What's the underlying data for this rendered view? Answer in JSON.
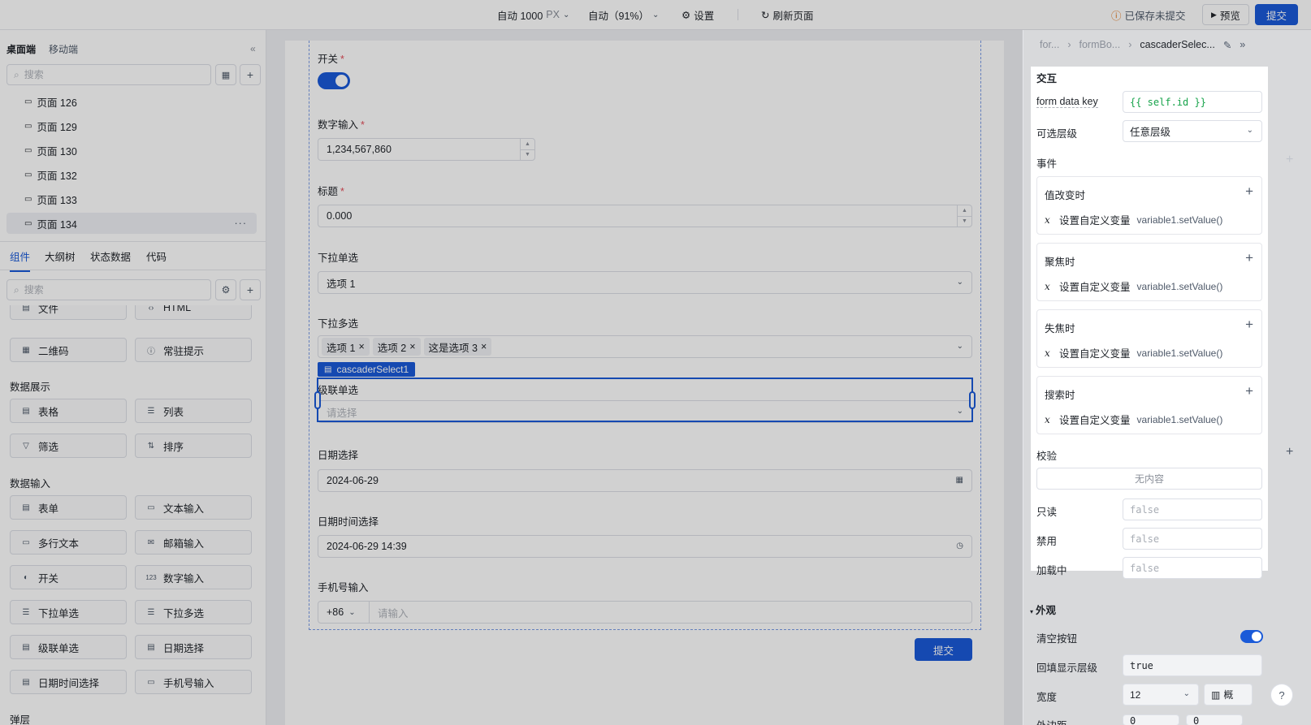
{
  "topbar": {
    "width_value": "自动 1000",
    "width_unit": "PX",
    "zoom": "自动（91%）",
    "settings": "设置",
    "refresh": "刷新页面",
    "save_status": "已保存未提交",
    "preview": "预览",
    "submit": "提交"
  },
  "left": {
    "tab_desktop": "桌面端",
    "tab_mobile": "移动端",
    "page_search_placeholder": "搜索",
    "pages": [
      "页面 126",
      "页面 129",
      "页面 130",
      "页面 132",
      "页面 133",
      "页面 134"
    ],
    "panel_tabs": [
      "组件",
      "大纲树",
      "状态数据",
      "代码"
    ],
    "component_search_placeholder": "搜索",
    "partial_row": [
      "文件",
      "HTML"
    ],
    "row_misc": [
      "二维码",
      "常驻提示"
    ],
    "section_display": "数据展示",
    "display_items": [
      "表格",
      "列表",
      "筛选",
      "排序"
    ],
    "section_input": "数据输入",
    "input_items": [
      "表单",
      "文本输入",
      "多行文本",
      "邮箱输入",
      "开关",
      "数字输入",
      "下拉单选",
      "下拉多选",
      "级联单选",
      "日期选择",
      "日期时间选择",
      "手机号输入"
    ],
    "section_overlay": "弹层"
  },
  "form": {
    "switch_label": "开关",
    "number_label": "数字输入",
    "number_value": "1,234,567,860",
    "title_label": "标题",
    "title_value": "0.000",
    "select_label": "下拉单选",
    "select_value": "选项 1",
    "multi_label": "下拉多选",
    "multi_tags": [
      "选项 1",
      "选项 2",
      "这是选项 3"
    ],
    "selected_component": "cascaderSelect1",
    "cascader_label": "级联单选",
    "cascader_placeholder": "请选择",
    "date_label": "日期选择",
    "date_value": "2024-06-29",
    "datetime_label": "日期时间选择",
    "datetime_value": "2024-06-29 14:39",
    "phone_label": "手机号输入",
    "phone_prefix": "+86",
    "phone_placeholder": "请输入",
    "submit": "提交",
    "required_mark": "*"
  },
  "right": {
    "breadcrumbs": [
      "for...",
      "formBo...",
      "cascaderSelec..."
    ],
    "section_interact": "交互",
    "form_data_key_label": "form data key",
    "form_data_key_value": "{{ self.id }}",
    "level_label": "可选层级",
    "level_value": "任意层级",
    "events_label": "事件",
    "events": [
      {
        "title": "值改变时",
        "action": "设置自定义变量",
        "code": "variable1.setValue()"
      },
      {
        "title": "聚焦时",
        "action": "设置自定义变量",
        "code": "variable1.setValue()"
      },
      {
        "title": "失焦时",
        "action": "设置自定义变量",
        "code": "variable1.setValue()"
      },
      {
        "title": "搜索时",
        "action": "设置自定义变量",
        "code": "variable1.setValue()"
      }
    ],
    "validate_label": "校验",
    "validate_empty": "无内容",
    "readonly_label": "只读",
    "readonly_placeholder": "false",
    "disabled_label": "禁用",
    "disabled_placeholder": "false",
    "loading_label": "加载中",
    "loading_placeholder": "false",
    "section_appearance": "外观",
    "clear_button_label": "清空按钮",
    "backfill_label": "回填显示层级",
    "backfill_value": "true",
    "width_label": "宽度",
    "width_value": "12",
    "width_mode": "概",
    "margin_label": "外边距",
    "margin_values": [
      "0",
      "0"
    ]
  },
  "colors": {
    "accent": "#1a5ad8",
    "required": "#e34d59"
  }
}
